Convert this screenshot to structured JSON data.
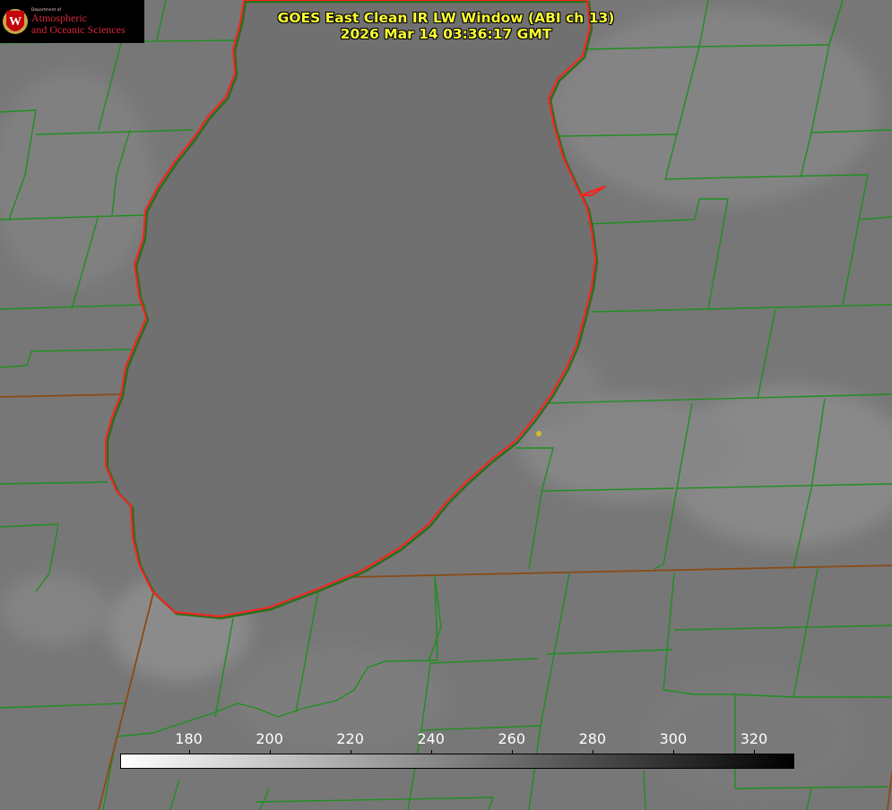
{
  "product": {
    "title": "GOES East Clean IR LW Window (ABI ch 13)",
    "timestamp": "2026 Mar 14 03:36:17 GMT"
  },
  "logo": {
    "department": "Department of",
    "line1": "Atmospheric",
    "line2": "and Oceanic Sciences",
    "seal_letter": "W"
  },
  "colorbar": {
    "min": 163,
    "max": 330,
    "color_low": "#ffffff",
    "color_high": "#000000",
    "ticks": [
      "180",
      "200",
      "220",
      "240",
      "260",
      "280",
      "300",
      "320"
    ]
  },
  "map_colors": {
    "county_lines": "#1f8f1f",
    "lake_outline": "#ff2020",
    "state_lines": "#8a4a14",
    "marker": "#d4c020"
  }
}
